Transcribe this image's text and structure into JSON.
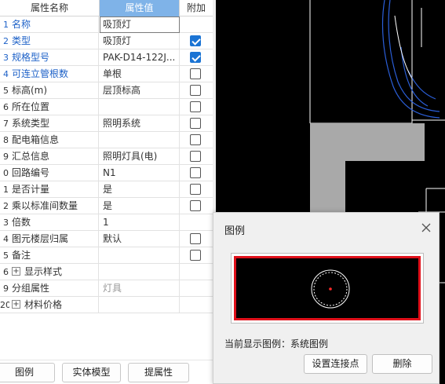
{
  "grid": {
    "headers": {
      "name": "属性名称",
      "value": "属性值",
      "extra": "附加"
    },
    "rows": [
      {
        "num": "1",
        "name": "名称",
        "value": "吸顶灯",
        "blue": true,
        "checkbox": "none",
        "editing": true
      },
      {
        "num": "2",
        "name": "类型",
        "value": "吸顶灯",
        "blue": true,
        "checkbox": "checked"
      },
      {
        "num": "3",
        "name": "规格型号",
        "value": "PAK-D14-122J...",
        "blue": true,
        "checkbox": "checked"
      },
      {
        "num": "4",
        "name": "可连立管根数",
        "value": "单根",
        "blue": true,
        "checkbox": "unchecked"
      },
      {
        "num": "5",
        "name": "标高(m)",
        "value": "层顶标高",
        "checkbox": "unchecked"
      },
      {
        "num": "6",
        "name": "所在位置",
        "value": "",
        "checkbox": "unchecked"
      },
      {
        "num": "7",
        "name": "系统类型",
        "value": "照明系统",
        "checkbox": "unchecked"
      },
      {
        "num": "8",
        "name": "配电箱信息",
        "value": "",
        "checkbox": "unchecked"
      },
      {
        "num": "9",
        "name": "汇总信息",
        "value": "照明灯具(电)",
        "checkbox": "unchecked"
      },
      {
        "num": "0",
        "name": "回路编号",
        "value": "N1",
        "checkbox": "unchecked"
      },
      {
        "num": "1",
        "name": "是否计量",
        "value": "是",
        "checkbox": "unchecked"
      },
      {
        "num": "2",
        "name": "乘以标准间数量",
        "value": "是",
        "checkbox": "unchecked"
      },
      {
        "num": "3",
        "name": "倍数",
        "value": "1",
        "checkbox": "none"
      },
      {
        "num": "4",
        "name": "图元楼层归属",
        "value": "默认",
        "checkbox": "unchecked"
      },
      {
        "num": "5",
        "name": "备注",
        "value": "",
        "checkbox": "unchecked"
      },
      {
        "num": "6",
        "name": "显示样式",
        "value": "",
        "group": true,
        "checkbox": "none"
      },
      {
        "num": "9",
        "name": "分组属性",
        "value": "灯具",
        "grey": true,
        "checkbox": "none"
      },
      {
        "num": "20",
        "name": "材料价格",
        "value": "",
        "group": true,
        "checkbox": "none"
      }
    ]
  },
  "toolbar": {
    "legend_label": "图例",
    "solid_model_label": "实体模型",
    "extract_props_label": "提属性"
  },
  "dialog": {
    "title": "图例",
    "current_label": "当前显示图例：系统图例",
    "set_point_label": "设置连接点",
    "delete_label": "删除",
    "close_icon": "close-icon"
  },
  "colors": {
    "header_accent": "#7fb3e8",
    "blue_text": "#1e62c8",
    "checkbox": "#1b74d4",
    "preview_border": "#e0101a",
    "cad_white": "#ffffff",
    "cad_blue": "#2b5fd9",
    "cad_grey": "#a9a9a9"
  }
}
